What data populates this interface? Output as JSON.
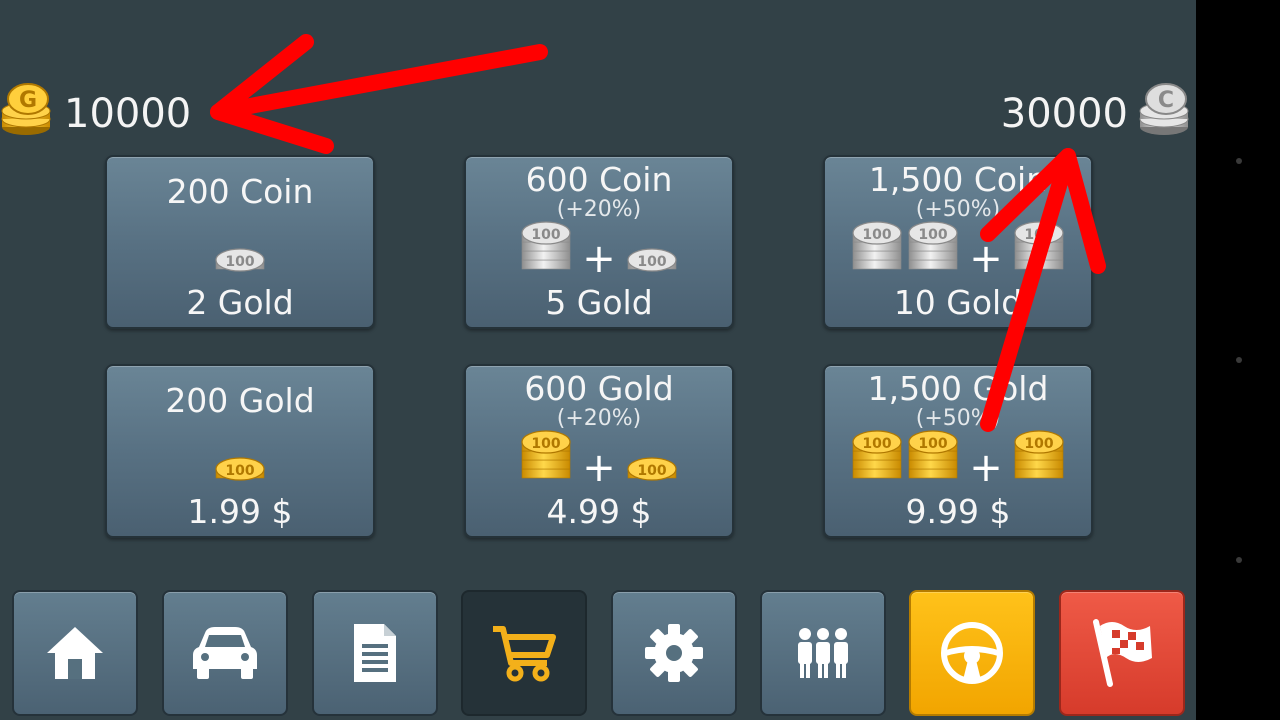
{
  "balances": {
    "gold": "10000",
    "coin": "30000"
  },
  "cards": [
    {
      "title": "200 Coin",
      "bonus": "",
      "price": "2 Gold"
    },
    {
      "title": "600 Coin",
      "bonus": "(+20%)",
      "price": "5 Gold"
    },
    {
      "title": "1,500 Coin",
      "bonus": "(+50%)",
      "price": "10 Gold"
    },
    {
      "title": "200 Gold",
      "bonus": "",
      "price": "1.99 $"
    },
    {
      "title": "600 Gold",
      "bonus": "(+20%)",
      "price": "4.99 $"
    },
    {
      "title": "1,500 Gold",
      "bonus": "(+50%)",
      "price": "9.99 $"
    }
  ],
  "coin_badge_text": "100",
  "toolbar": [
    {
      "icon": "home-icon"
    },
    {
      "icon": "car-icon"
    },
    {
      "icon": "document-icon"
    },
    {
      "icon": "cart-icon",
      "active": true
    },
    {
      "icon": "gear-icon"
    },
    {
      "icon": "team-icon"
    },
    {
      "icon": "steering-wheel-icon"
    },
    {
      "icon": "flag-icon"
    }
  ],
  "colors": {
    "background": "#324147",
    "card": "#587183",
    "gold": "#f2b81d",
    "silver": "#c9c9c9",
    "accent_orange": "#ffb400",
    "accent_red": "#e04a38",
    "annotation_arrow": "#ff0000"
  }
}
